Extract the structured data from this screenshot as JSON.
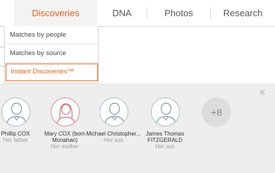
{
  "nav": {
    "tabs": [
      {
        "label": "Discoveries",
        "active": true
      },
      {
        "label": "DNA",
        "active": false
      },
      {
        "label": "Photos",
        "active": false
      },
      {
        "label": "Research",
        "active": false
      }
    ]
  },
  "dropdown": {
    "items": [
      {
        "label": "Matches by people"
      },
      {
        "label": "Matches by source"
      },
      {
        "label": "Instant Discoveries™",
        "selected": true
      }
    ]
  },
  "discoveries_panel": {
    "close_icon": "close-icon",
    "people": [
      {
        "name": "Phillip COX",
        "relation": "Her father",
        "gender": "male"
      },
      {
        "name": "Mary COX (born Monahan)",
        "relation": "Her mother",
        "gender": "female"
      },
      {
        "name": "Michael Christopher...",
        "relation": "Her son",
        "gender": "male"
      },
      {
        "name": "James Thomas FITZGERALD",
        "relation": "Her son",
        "gender": "male"
      }
    ],
    "more_count": "+8"
  },
  "colors": {
    "accent": "#e0601f",
    "male_ring": "#a9bfcb",
    "female_ring": "#d98a8f",
    "panel_bg": "#eeeeee"
  }
}
